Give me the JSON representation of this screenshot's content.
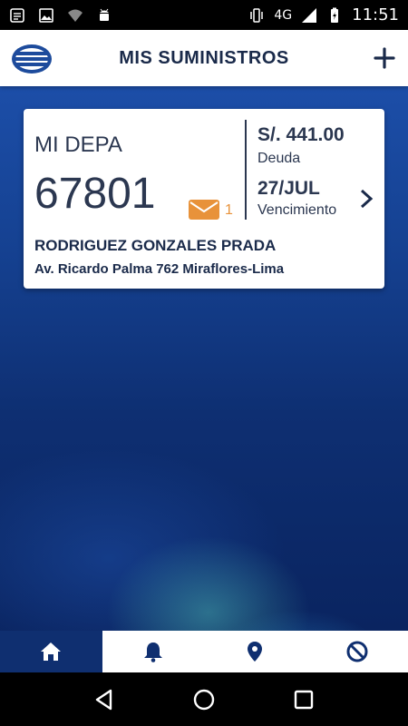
{
  "status_bar": {
    "network": "4G",
    "time": "11:51",
    "icons": [
      "notification-icon",
      "image-icon",
      "wifi-icon",
      "android-icon",
      "vibrate-icon",
      "signal-icon",
      "battery-icon"
    ]
  },
  "header": {
    "title": "MIS SUMINISTROS",
    "logo": "company-logo",
    "add_icon": "plus-icon"
  },
  "supply_card": {
    "name": "MI DEPA",
    "number": "67801",
    "message_count": "1",
    "debt_amount": "S/. 441.00",
    "debt_label": "Deuda",
    "due_date": "27/JUL",
    "due_label": "Vencimiento",
    "holder": "RODRIGUEZ GONZALES PRADA",
    "address": "Av. Ricardo Palma 762 Miraflores-Lima"
  },
  "bottom_nav": {
    "items": [
      {
        "icon": "home-icon",
        "active": true
      },
      {
        "icon": "bell-icon",
        "active": false
      },
      {
        "icon": "location-pin-icon",
        "active": false
      },
      {
        "icon": "block-icon",
        "active": false
      }
    ]
  },
  "system_nav": {
    "icons": [
      "back-icon",
      "home-circle-icon",
      "recents-icon"
    ]
  },
  "colors": {
    "primary": "#0f2f70",
    "accent": "#e8923a",
    "text": "#2b3750"
  }
}
